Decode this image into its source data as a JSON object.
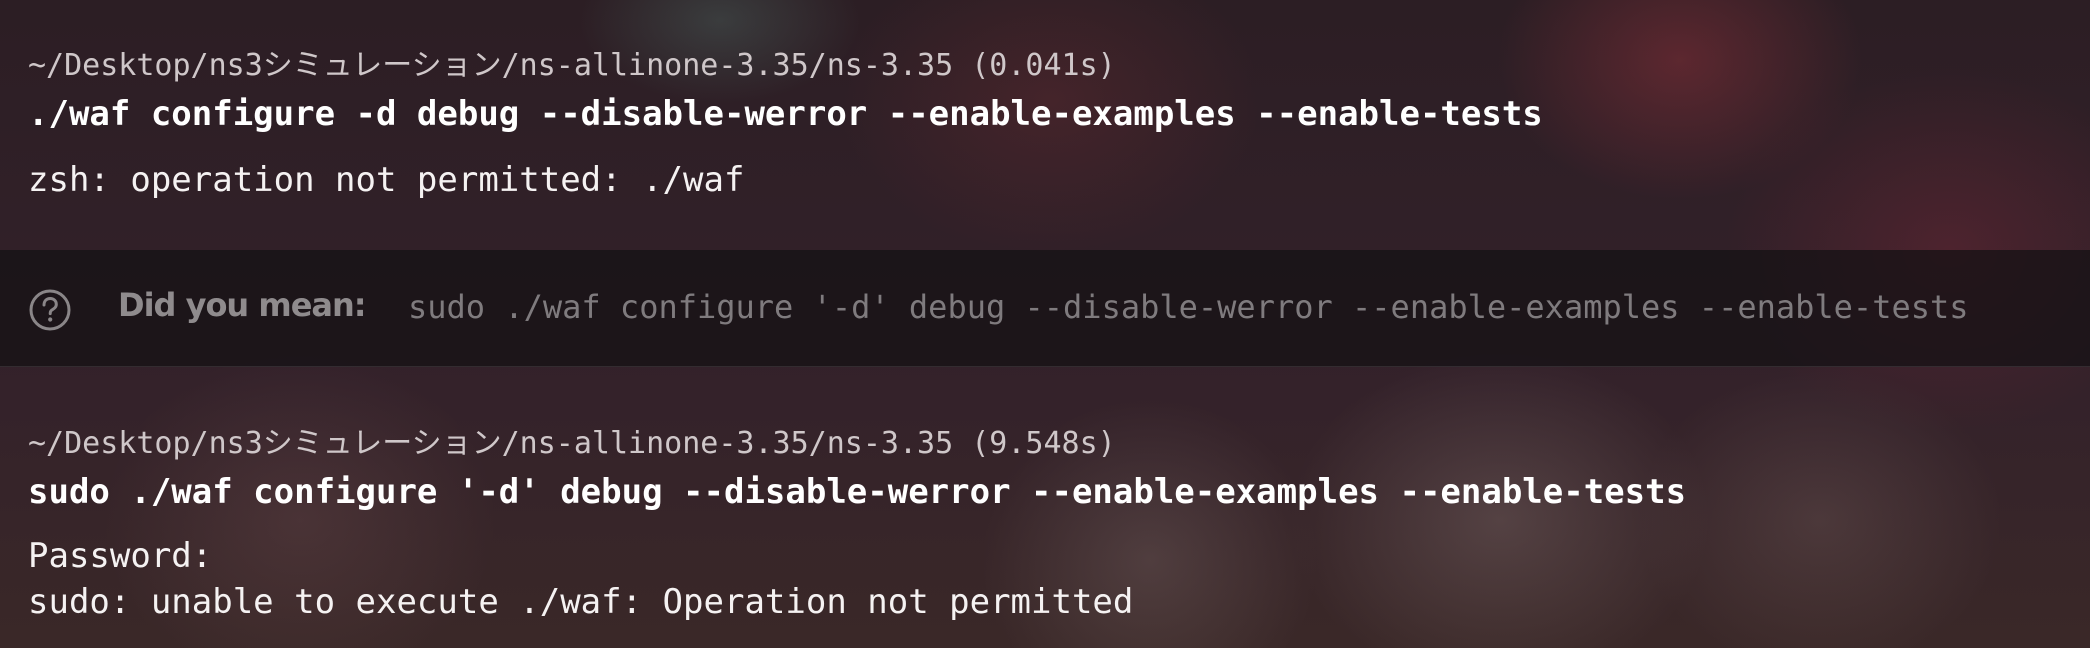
{
  "blocks": [
    {
      "cwd": "~/Desktop/ns3シミュレーション/ns-allinone-3.35/ns-3.35 (0.041s)",
      "command": "./waf configure -d debug --disable-werror --enable-examples --enable-tests",
      "output": [
        "zsh: operation not permitted: ./waf"
      ]
    },
    {
      "cwd": "~/Desktop/ns3シミュレーション/ns-allinone-3.35/ns-3.35 (9.548s)",
      "command": "sudo ./waf configure '-d' debug --disable-werror --enable-examples --enable-tests",
      "output": [
        "Password:",
        "sudo: unable to execute ./waf: Operation not permitted"
      ]
    }
  ],
  "suggestion": {
    "icon": "help-circle-icon",
    "label": "Did you mean:",
    "command": "sudo ./waf configure '-d' debug --disable-werror --enable-examples --enable-tests"
  }
}
